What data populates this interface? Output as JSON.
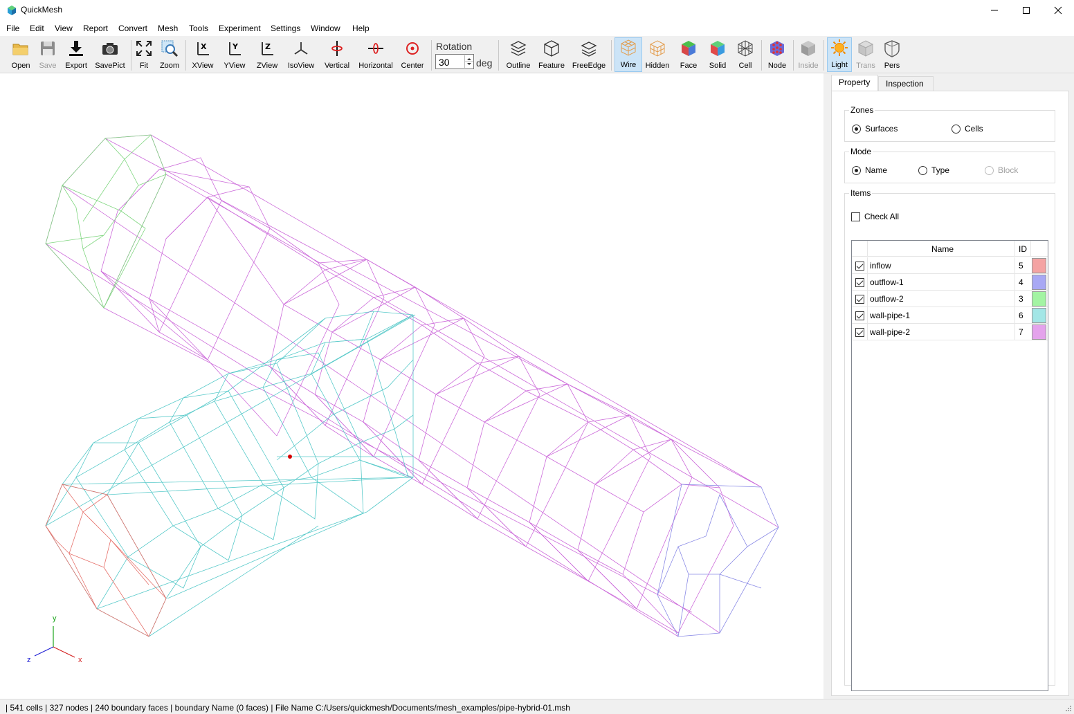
{
  "window": {
    "title": "QuickMesh"
  },
  "menu": [
    "File",
    "Edit",
    "View",
    "Report",
    "Convert",
    "Mesh",
    "Tools",
    "Experiment",
    "Settings",
    "Window",
    "Help"
  ],
  "toolbar": {
    "open": "Open",
    "save": "Save",
    "export": "Export",
    "savepict": "SavePict",
    "fit": "Fit",
    "zoom": "Zoom",
    "xview": "XView",
    "yview": "YView",
    "zview": "ZView",
    "isoview": "IsoView",
    "vertical": "Vertical",
    "horizontal": "Horizontal",
    "center": "Center",
    "rotation_label": "Rotation",
    "rotation_value": "30",
    "rotation_unit": "deg",
    "outline": "Outline",
    "feature": "Feature",
    "freeedge": "FreeEdge",
    "wire": "Wire",
    "hidden": "Hidden",
    "face": "Face",
    "solid": "Solid",
    "cell": "Cell",
    "node": "Node",
    "inside": "Inside",
    "light": "Light",
    "trans": "Trans",
    "pers": "Pers"
  },
  "panel": {
    "tabs": [
      "Property",
      "Inspection"
    ],
    "zones": {
      "title": "Zones",
      "surfaces": "Surfaces",
      "cells": "Cells",
      "selected": "Surfaces"
    },
    "mode": {
      "title": "Mode",
      "name": "Name",
      "type": "Type",
      "block": "Block",
      "selected": "Name"
    },
    "items": {
      "title": "Items",
      "check_all": "Check All",
      "col_name": "Name",
      "col_id": "ID",
      "rows": [
        {
          "name": "inflow",
          "id": "5",
          "color": "#f4a3a3",
          "checked": true
        },
        {
          "name": "outflow-1",
          "id": "4",
          "color": "#a8a8f4",
          "checked": true
        },
        {
          "name": "outflow-2",
          "id": "3",
          "color": "#a3f4a3",
          "checked": true
        },
        {
          "name": "wall-pipe-1",
          "id": "6",
          "color": "#a3e6e6",
          "checked": true
        },
        {
          "name": "wall-pipe-2",
          "id": "7",
          "color": "#e4a3ec",
          "checked": true
        }
      ]
    }
  },
  "axes": {
    "x": "x",
    "y": "y",
    "z": "z"
  },
  "status": "| 541 cells | 327 nodes | 240 boundary faces |  boundary Name  (0 faces) | File Name C:/Users/quickmesh/Documents/mesh_examples/pipe-hybrid-01.msh"
}
